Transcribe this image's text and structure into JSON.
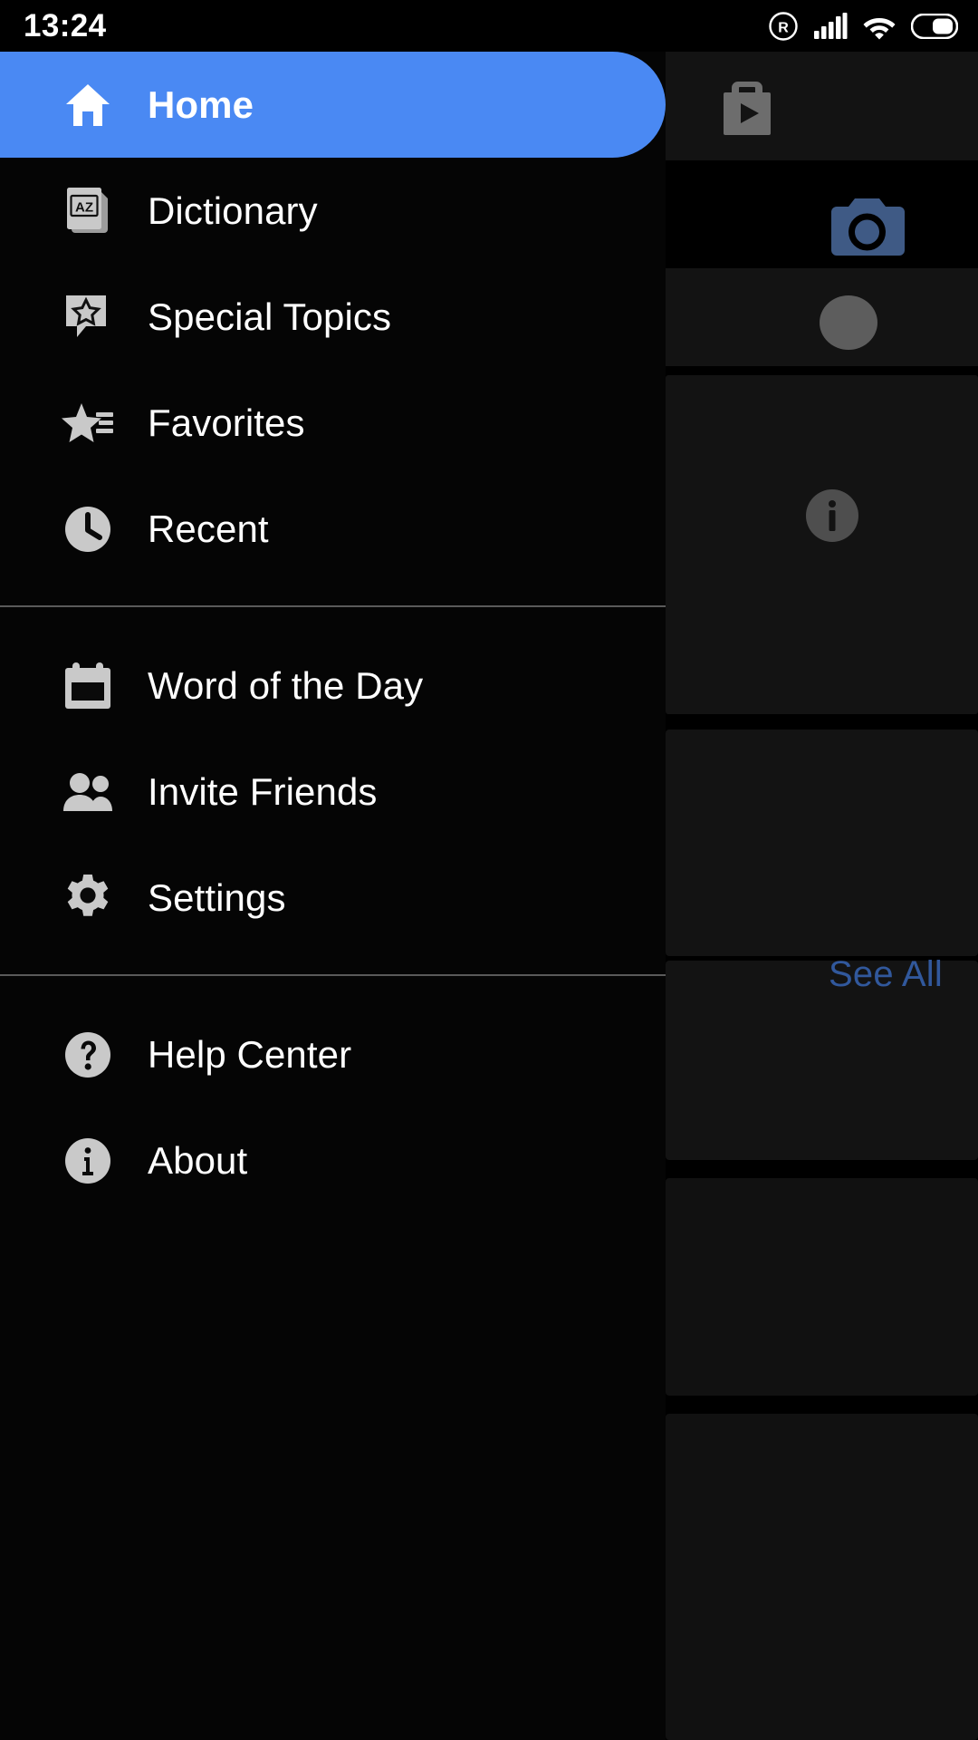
{
  "statusbar": {
    "time": "13:24",
    "icons": [
      {
        "name": "roaming-r-icon",
        "label": "R"
      },
      {
        "name": "cellular-signal-icon",
        "label": "signal"
      },
      {
        "name": "wifi-icon",
        "label": "wifi"
      },
      {
        "name": "battery-icon",
        "label": "battery"
      }
    ]
  },
  "drawer": {
    "accent_color": "#4a89f3",
    "background_color": "#050505",
    "icon_color": "#c9c9c9",
    "text_color": "#ffffff",
    "divider_color": "#5a5a5a",
    "groups": [
      {
        "items": [
          {
            "label": "Home",
            "icon": "home-icon",
            "selected": true
          },
          {
            "label": "Dictionary",
            "icon": "dictionary-book-az-icon",
            "selected": false
          },
          {
            "label": "Special Topics",
            "icon": "speech-bubble-star-icon",
            "selected": false
          },
          {
            "label": "Favorites",
            "icon": "star-list-icon",
            "selected": false
          },
          {
            "label": "Recent",
            "icon": "clock-icon",
            "selected": false
          }
        ]
      },
      {
        "items": [
          {
            "label": "Word of the Day",
            "icon": "calendar-icon",
            "selected": false
          },
          {
            "label": "Invite Friends",
            "icon": "people-group-icon",
            "selected": false
          },
          {
            "label": "Settings",
            "icon": "gear-icon",
            "selected": false
          }
        ]
      },
      {
        "items": [
          {
            "label": "Help Center",
            "icon": "question-mark-circle-icon",
            "selected": false
          },
          {
            "label": "About",
            "icon": "info-circle-icon",
            "selected": false
          }
        ]
      }
    ]
  },
  "background_app": {
    "see_all_label": "See All",
    "see_all_color": "#31589c",
    "icons": [
      {
        "name": "shop-bag-play-icon"
      },
      {
        "name": "camera-icon"
      },
      {
        "name": "avatar-circle-icon"
      },
      {
        "name": "info-circle-icon"
      }
    ]
  }
}
